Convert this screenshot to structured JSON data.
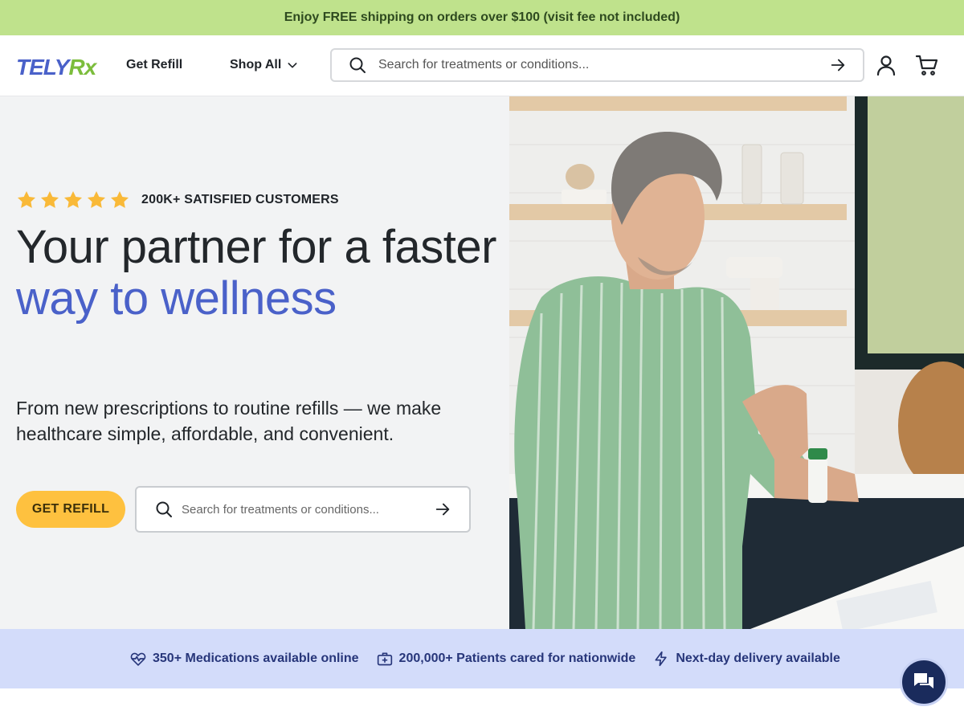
{
  "promo": {
    "text": "Enjoy FREE shipping on orders over $100 (visit fee not included)"
  },
  "header": {
    "logo": {
      "part1": "TELY",
      "part2": "Rx"
    },
    "nav": {
      "get_refill": "Get Refill",
      "shop_all": "Shop All"
    },
    "search": {
      "placeholder": "Search for treatments or conditions..."
    },
    "icons": [
      "search-icon",
      "arrow-right-icon",
      "user-icon",
      "cart-icon"
    ]
  },
  "hero": {
    "rating": {
      "stars": 5,
      "text": "200K+ SATISFIED CUSTOMERS"
    },
    "headline": {
      "line1": "Your partner for a faster",
      "line2": "way to wellness"
    },
    "subtext": "From new prescriptions to routine refills — we make healthcare simple, affordable, and convenient.",
    "cta_label": "GET REFILL",
    "search": {
      "placeholder": "Search for treatments or conditions..."
    },
    "colors": {
      "accent": "#4a61c9",
      "cta": "#fec13f",
      "star": "#f9b938"
    }
  },
  "stats": {
    "items": [
      {
        "icon": "heart-pulse-icon",
        "text": "350+ Medications available online"
      },
      {
        "icon": "medical-kit-icon",
        "text": "200,000+ Patients cared for nationwide"
      },
      {
        "icon": "lightning-icon",
        "text": "Next-day delivery available"
      }
    ]
  },
  "chat": {
    "icon": "chat-icon"
  }
}
